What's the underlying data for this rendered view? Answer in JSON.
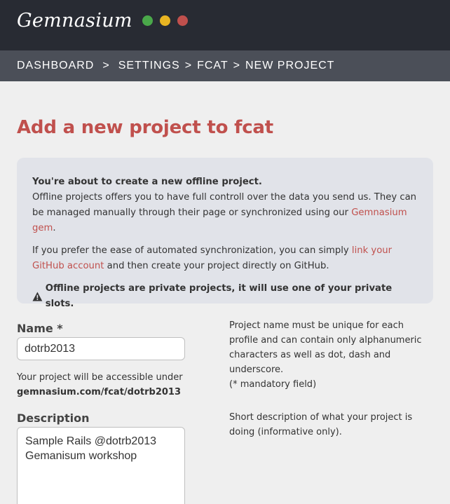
{
  "app": {
    "logo_text": "Gemnasium",
    "window_dots": [
      "#4aa84a",
      "#e8b422",
      "#c0504d"
    ]
  },
  "breadcrumb": {
    "items": [
      "DASHBOARD",
      "SETTINGS",
      "FCAT",
      "NEW PROJECT"
    ],
    "separators": [
      ">",
      ">",
      ">"
    ]
  },
  "page": {
    "title": "Add a new project to fcat"
  },
  "notice": {
    "heading": "You're about to create a new offline project.",
    "line1_prefix": "Offline projects offers you to have full controll over the data you send us. They can be managed manually through their page or synchronized using our ",
    "gem_link": "Gemnasium gem",
    "line1_suffix": ".",
    "line2_prefix": "If you prefer the ease of automated synchronization, you can simply ",
    "github_link": "link your GitHub account",
    "line2_suffix": " and then create your project directly on GitHub.",
    "warning_icon": "warning-triangle-icon",
    "warning": "Offline projects are private projects, it will use one of your private slots."
  },
  "form": {
    "name": {
      "label": "Name *",
      "value": "dotrb2013",
      "hint_prefix": "Your project will be accessible under",
      "hint_url": "gemnasium.com/fcat/dotrb2013",
      "help": "Project name must be unique for each profile and can contain only alphanumeric characters as well as dot, dash and underscore.",
      "help_note": "(* mandatory field)"
    },
    "description": {
      "label": "Description",
      "value": "Sample Rails @dotrb2013\nGemanisum workshop",
      "help": "Short description of what your project is doing (informative only)."
    }
  },
  "colors": {
    "accent": "#c0504d",
    "topbar": "#282b33",
    "crumbbar": "#4b4f58",
    "notice_bg": "#e1e3e9"
  }
}
